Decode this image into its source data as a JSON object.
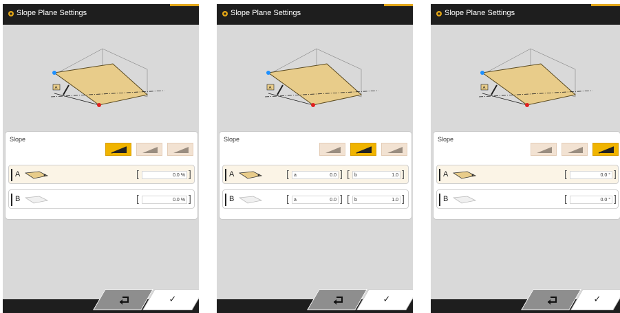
{
  "panels": [
    {
      "title": "Slope Plane Settings",
      "slope_label": "Slope",
      "active_mode": 0,
      "rows": [
        {
          "letter": "A",
          "fields": [
            {
              "prefix": "",
              "value": "0.0 %"
            }
          ]
        },
        {
          "letter": "B",
          "fields": [
            {
              "prefix": "",
              "value": "0.0 %"
            }
          ]
        }
      ],
      "back_icon": "return-arrow-icon",
      "ok_label": "✓"
    },
    {
      "title": "Slope Plane Settings",
      "slope_label": "Slope",
      "active_mode": 1,
      "rows": [
        {
          "letter": "A",
          "fields": [
            {
              "prefix": "a",
              "value": "0.0"
            },
            {
              "prefix": "b",
              "value": "1.0"
            }
          ]
        },
        {
          "letter": "B",
          "fields": [
            {
              "prefix": "a",
              "value": "0.0"
            },
            {
              "prefix": "b",
              "value": "1.0"
            }
          ]
        }
      ],
      "back_icon": "return-arrow-icon",
      "ok_label": "✓"
    },
    {
      "title": "Slope Plane Settings",
      "slope_label": "Slope",
      "active_mode": 2,
      "rows": [
        {
          "letter": "A",
          "fields": [
            {
              "prefix": "",
              "value": "0.0 °"
            }
          ]
        },
        {
          "letter": "B",
          "fields": [
            {
              "prefix": "",
              "value": "0.0 °"
            }
          ]
        }
      ],
      "back_icon": "return-arrow-icon",
      "ok_label": "✓"
    }
  ],
  "diagram_label": "A",
  "colors": {
    "accent": "#f0b400",
    "plane": "#e8cc8a",
    "point_blue": "#1e90ff",
    "point_red": "#e02020"
  }
}
